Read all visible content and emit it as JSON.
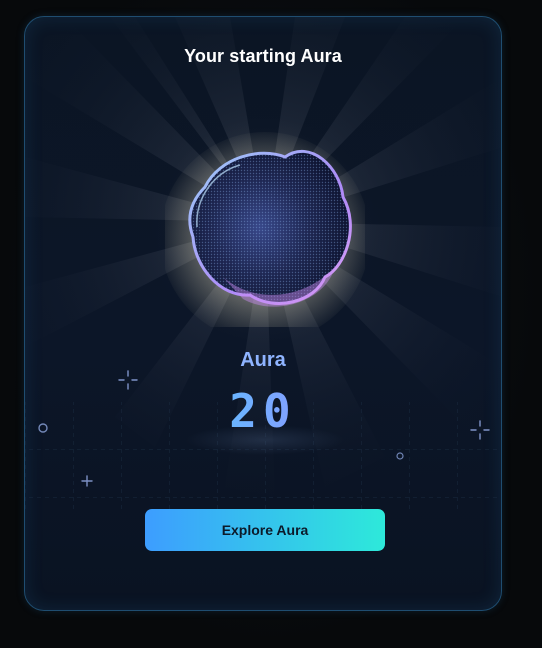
{
  "card": {
    "title": "Your starting Aura"
  },
  "aura": {
    "label": "Aura",
    "value": "20"
  },
  "actions": {
    "explore_label": "Explore Aura"
  },
  "colors": {
    "card_border": "#1f4d70",
    "card_bg": "#0b1524",
    "label": "#8fb4ff",
    "value_gradient_start": "#52c8ff",
    "value_gradient_end": "#9a8dff",
    "button_gradient_start": "#3d9dff",
    "button_gradient_end": "#2de9da"
  },
  "icons": [
    "sparkle-icon",
    "ring-icon",
    "plus-icon",
    "dot-ring-icon"
  ]
}
